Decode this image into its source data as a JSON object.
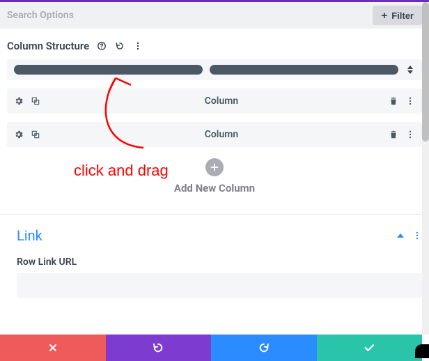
{
  "search": {
    "placeholder": "Search Options"
  },
  "filter": {
    "label": "Filter",
    "plus": "+"
  },
  "columnStructure": {
    "title": "Column Structure",
    "columns": [
      {
        "label": "Column"
      },
      {
        "label": "Column"
      }
    ],
    "addLabel": "Add New Column"
  },
  "link": {
    "title": "Link",
    "field_label": "Row Link URL",
    "field_value": ""
  },
  "annotation": {
    "text": "click and drag"
  },
  "bottom": {
    "close": "close",
    "undo": "undo",
    "redo": "redo",
    "confirm": "confirm"
  },
  "colors": {
    "accent_purple": "#6c2eb9",
    "link_blue": "#2a8cff",
    "red": "#ef5a5a",
    "green": "#29c4a9"
  }
}
